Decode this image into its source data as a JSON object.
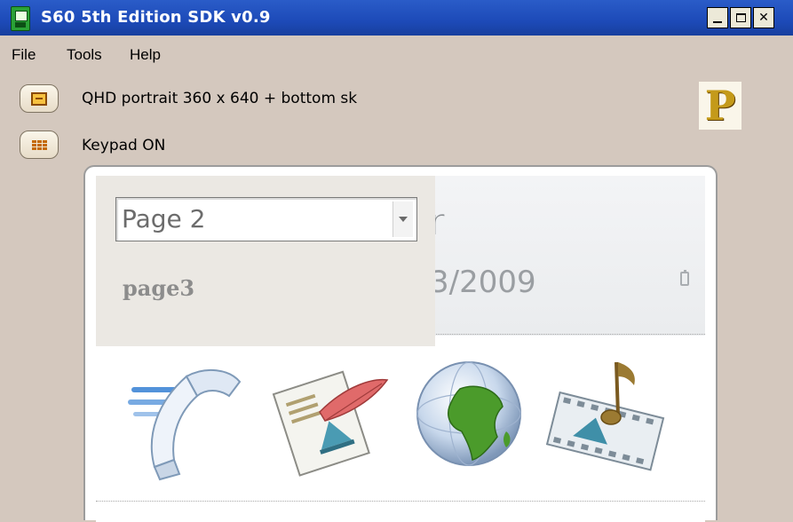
{
  "window": {
    "title": "S60 5th Edition SDK v0.9",
    "icon": "phone-app-icon",
    "controls": [
      "minimize",
      "maximize",
      "close"
    ],
    "close_glyph": "✕"
  },
  "menu": {
    "items": [
      "File",
      "Tools",
      "Help"
    ]
  },
  "toolbar": {
    "layout_label": "QHD portrait 360 x 640 + bottom sk",
    "keypad_label": "Keypad ON"
  },
  "logo": {
    "letter": "P",
    "color": "#c49a1a"
  },
  "phone_screen": {
    "background_title_fragment": "r",
    "background_date_fragment": "3/2009",
    "page_selector": {
      "selected": "Page 2",
      "option_under": "page3"
    },
    "app_icons": [
      "phone-icon",
      "messaging-icon",
      "web-globe-icon",
      "media-icon"
    ]
  },
  "colors": {
    "titlebar": "#1d4ab8",
    "background": "#d4c8be",
    "overlay": "#ebe8e3"
  }
}
